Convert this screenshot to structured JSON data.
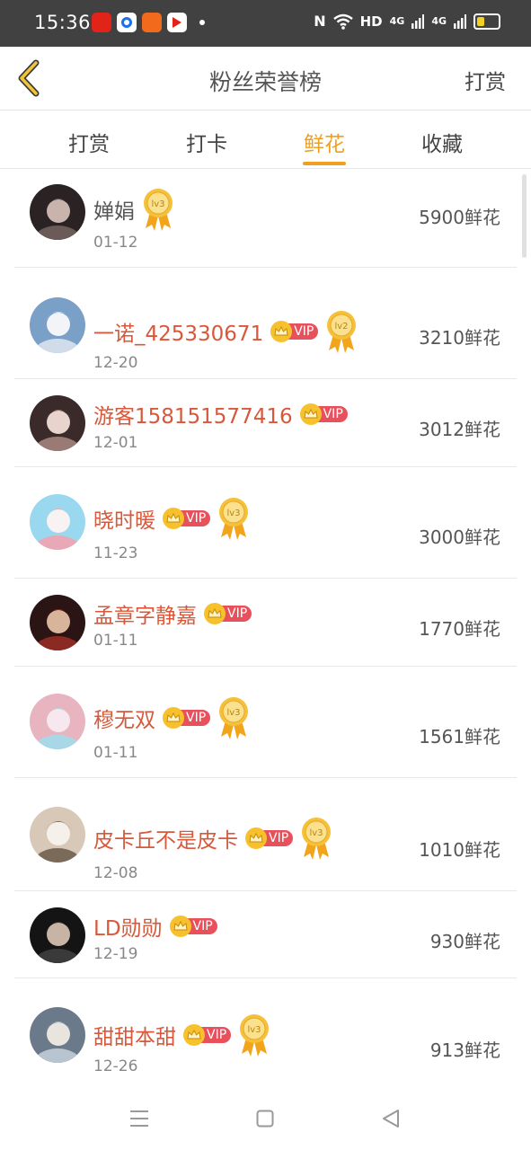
{
  "status_bar": {
    "time": "15:36",
    "network": "HD",
    "signal1": "4G",
    "signal2": "4G",
    "battery_level": 0.35
  },
  "header": {
    "title": "粉丝荣誉榜",
    "action": "打赏",
    "back_icon": "chevron-left-icon"
  },
  "tabs": [
    {
      "label": "打赏",
      "active": false
    },
    {
      "label": "打卡",
      "active": false
    },
    {
      "label": "鲜花",
      "active": true
    },
    {
      "label": "收藏",
      "active": false
    }
  ],
  "vip_label": "VIP",
  "list": [
    {
      "name": "婵娟",
      "date": "01-12",
      "flowers": "5900鲜花",
      "vip": false,
      "level": "lv3"
    },
    {
      "name": "一诺_425330671",
      "date": "12-20",
      "flowers": "3210鲜花",
      "vip": true,
      "level": "lv2"
    },
    {
      "name": "游客158151577416",
      "date": "12-01",
      "flowers": "3012鲜花",
      "vip": true,
      "level": ""
    },
    {
      "name": "晓时暖",
      "date": "11-23",
      "flowers": "3000鲜花",
      "vip": true,
      "level": "lv3"
    },
    {
      "name": "孟章字静嘉",
      "date": "01-11",
      "flowers": "1770鲜花",
      "vip": true,
      "level": ""
    },
    {
      "name": "穆无双",
      "date": "01-11",
      "flowers": "1561鲜花",
      "vip": true,
      "level": "lv3"
    },
    {
      "name": "皮卡丘不是皮卡",
      "date": "12-08",
      "flowers": "1010鲜花",
      "vip": true,
      "level": "lv3"
    },
    {
      "name": "LD勋勋",
      "date": "12-19",
      "flowers": "930鲜花",
      "vip": true,
      "level": ""
    },
    {
      "name": "甜甜本甜",
      "date": "12-26",
      "flowers": "913鲜花",
      "vip": true,
      "level": "lv3"
    }
  ],
  "colors": {
    "accent": "#f0a020",
    "name_red": "#d7583a",
    "vip_red": "#e8505b"
  }
}
